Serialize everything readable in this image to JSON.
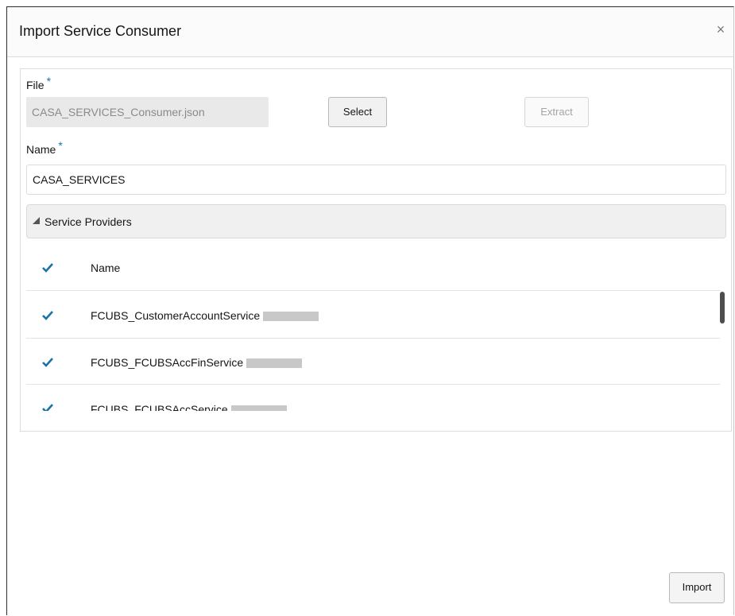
{
  "dialog": {
    "title": "Import Service Consumer",
    "close_icon": "×"
  },
  "form": {
    "file_label": "File",
    "file_required": "*",
    "file_value": "CASA_SERVICES_Consumer.json",
    "select_label": "Select",
    "extract_label": "Extract",
    "name_label": "Name",
    "name_required": "*",
    "name_value": "CASA_SERVICES"
  },
  "providers": {
    "section_label": "Service Providers",
    "header_label": "Name",
    "rows": [
      {
        "name": "FCUBS_CustomerAccountService",
        "checked": true
      },
      {
        "name": "FCUBS_FCUBSAccFinService",
        "checked": true
      },
      {
        "name": "FCUBS_FCUBSAccService",
        "checked": true
      }
    ]
  },
  "footer": {
    "import_label": "Import"
  },
  "colors": {
    "accent": "#1a73a8",
    "redaction": "#c8c8c8"
  }
}
